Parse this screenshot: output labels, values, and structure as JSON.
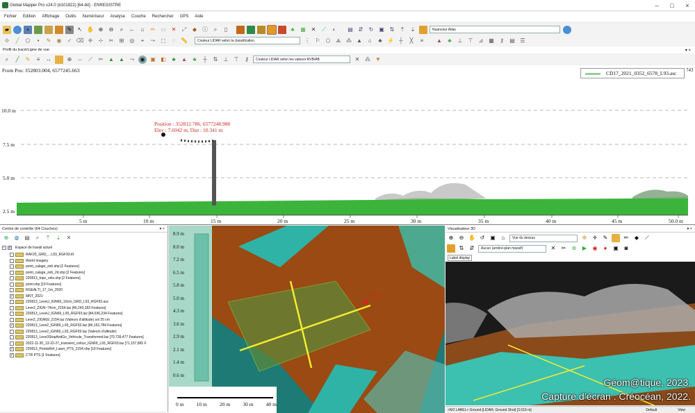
{
  "window": {
    "title": "Global Mapper Pro v24.0 (b101822) [64-bit] - ENREGISTRE",
    "controls": [
      "–",
      "□",
      "×"
    ]
  },
  "menu": [
    "Fichier",
    "Edition",
    "Affichage",
    "Outils",
    "Numériseur",
    "Analyse",
    "Couche",
    "Rechercher",
    "GPS",
    "Aide"
  ],
  "toolbar": {
    "shader_combo": "Nuanceur Atlas",
    "lidar_class_combo": "Couleur LIDAR selon la classification"
  },
  "profile": {
    "panel_title": "Profil du tracé/Ligne de vue",
    "lidar_rgb_combo": "Couleur LIDAR selon les valeurs RVB/AB",
    "from_pos": "From Pos: 352803.004, 6577245.663",
    "legend_label": "CD17_2021_0352_6578_L93.asc",
    "edge_value": "743",
    "position_line1": "Position : 352812.786, 6577248.988",
    "position_line2": "Elev : 7.6942 m, Dist : 10.341 m",
    "y_ticks": [
      "10.0 m",
      "7.5 m",
      "5.0 m",
      "2.5 m"
    ],
    "x_ticks": [
      "5 m",
      "10 m",
      "15 m",
      "20 m",
      "25 m",
      "30 m",
      "35 m",
      "40 m",
      "45 m",
      "50.0 m"
    ]
  },
  "control_center": {
    "title": "Centre de contrôle (64 Couches)",
    "workspace": "Espace de travail actuel",
    "layers": [
      {
        "name": "RAF20_GRD_...L93_RGF93.tif",
        "checked": false,
        "icon": "IMG"
      },
      {
        "name": "World Imagery",
        "checked": false,
        "icon": "IMG"
      },
      {
        "name": "point_calage_zeb.shp [2 Features]",
        "checked": false,
        "icon": "SHP"
      },
      {
        "name": "point_calage_zeb_2d.shp [2 Features]",
        "checked": false,
        "icon": "SHP"
      },
      {
        "name": "220813_topo_velo.shp [2 Features]",
        "checked": false,
        "icon": "SHP"
      },
      {
        "name": "point.shp [19 Features]",
        "checked": false,
        "icon": "SHP"
      },
      {
        "name": "RGEALTI_17_1m_2020",
        "checked": false,
        "icon": "DEM"
      },
      {
        "name": "MNT_2021",
        "checked": true,
        "icon": "DEM"
      },
      {
        "name": "220813_LeveU_IGN69_10cm_GRD_L93_RGF93.asc",
        "checked": false,
        "icon": "ASC"
      },
      {
        "name": "Leve2_ZIGN~74cm_2154.laz [46,243,183 Features]",
        "checked": false,
        "icon": "LAZ"
      },
      {
        "name": "220813_LeveU_IGN69_L93_RGF93.laz [84,036,234 Features]",
        "checked": false,
        "icon": "LAZ"
      },
      {
        "name": "Leve2_ZIGN69_2154.laz (Valeurs d'altitude) sol 25 cm",
        "checked": false,
        "icon": "LAZ"
      },
      {
        "name": "220813_Leve2_IGN69_L93_RGF93.laz [46,152,784 Features]",
        "checked": true,
        "icon": "LAZ"
      },
      {
        "name": "220813_Leve2_IGN69_L93_RGF93.laz (Valeurs d'altitude)",
        "checked": false,
        "icon": "LAZ"
      },
      {
        "name": "220813_Leve3StopAndGo_Vehicule_Transformed.laz [70,739,477 Features]",
        "checked": false,
        "icon": "LAZ"
      },
      {
        "name": "2022-11-30_13-22-27_transient_colour_IGN69_L93_RGF93.laz [71,157,865 F",
        "checked": false,
        "icon": "LAZ"
      },
      {
        "name": "220813_PointsRef_Laser_PTS_2154.shp [19 Features]",
        "checked": true,
        "icon": "SHP"
      },
      {
        "name": "CTR PTS [1 Features]",
        "checked": true,
        "icon": "SHP"
      }
    ]
  },
  "map": {
    "scale_labels": [
      "8.9 m",
      "8.0 m",
      "7.2 m",
      "6.5 m",
      "5.8 m",
      "5.0 m",
      "4.3 m",
      "3.6 m",
      "2.9 m",
      "2.1 m",
      "1.4 m",
      "0.6 m"
    ],
    "scalebar_labels": [
      "0 m",
      "10 m",
      "20 m",
      "30 m",
      "40 m"
    ],
    "marker_label": "CTR P..."
  },
  "viewer3d": {
    "title": "Visualisateur 3D",
    "view_combo": "Vue du dessus",
    "background_combo": "Aucun (arrière-plan massif)",
    "label_button": "Label display",
    "status": "<NO LABEL> Ground [LIDAR, Ground Shot] [3.019 m]",
    "status_right": [
      "Default",
      "View"
    ]
  },
  "credits": {
    "line1": "Géom@tique, 2023.",
    "line2": "Capture d’écran : Créocéan, 2022."
  },
  "colors": {
    "ground": "#3cb43c",
    "soil": "#9a4a12",
    "water": "#33b3a8",
    "profile_red": "#cc2222"
  }
}
